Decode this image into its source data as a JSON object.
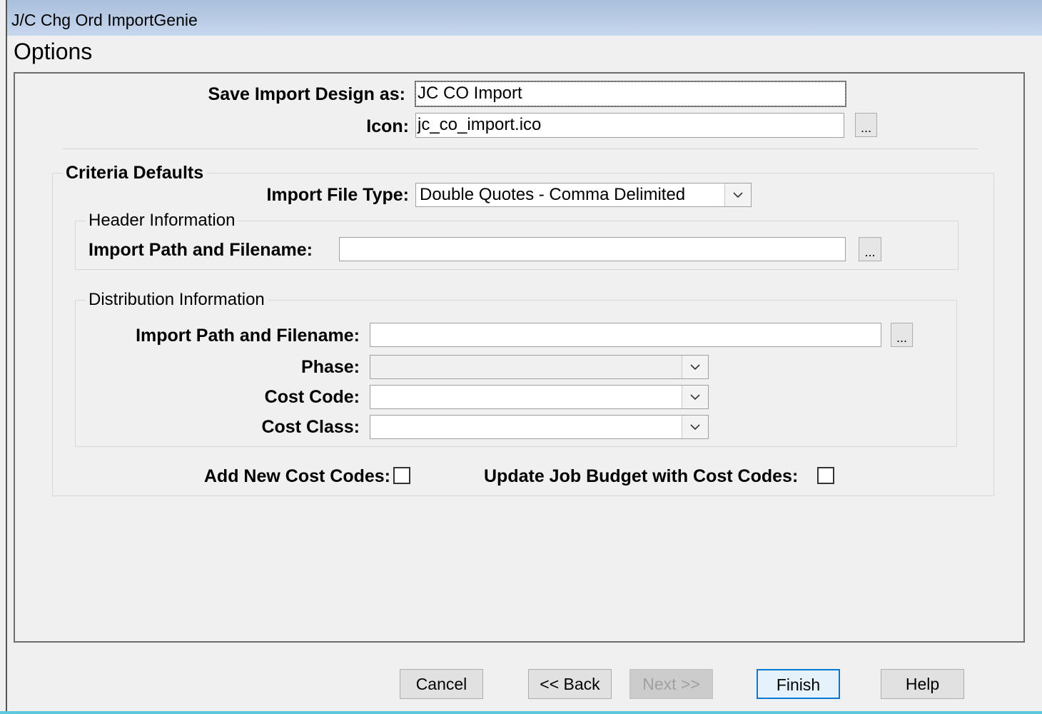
{
  "window": {
    "title": "J/C Chg Ord ImportGenie",
    "heading": "Options"
  },
  "design": {
    "save_label": "Save Import Design as:",
    "save_value": "JC CO Import",
    "icon_label": "Icon:",
    "icon_value": "jc_co_import.ico",
    "browse": "..."
  },
  "criteria": {
    "legend": "Criteria Defaults",
    "file_type_label": "Import File Type:",
    "file_type_value": "Double Quotes - Comma Delimited"
  },
  "header_info": {
    "legend": "Header Information",
    "path_label": "Import Path and Filename:",
    "path_value": ""
  },
  "distribution": {
    "legend": "Distribution Information",
    "path_label": "Import Path and Filename:",
    "path_value": "",
    "phase_label": "Phase:",
    "phase_value": "",
    "cost_code_label": "Cost Code:",
    "cost_code_value": "",
    "cost_class_label": "Cost Class:",
    "cost_class_value": ""
  },
  "options": {
    "add_cost_codes_label": "Add New Cost Codes:",
    "add_cost_codes_checked": false,
    "update_budget_label": "Update Job Budget with Cost Codes:",
    "update_budget_checked": false
  },
  "buttons": {
    "cancel": "Cancel",
    "back": "<< Back",
    "next": "Next >>",
    "finish": "Finish",
    "help": "Help"
  },
  "colors": {
    "default_button_border": "#0078d7",
    "title_gradient_top": "#a9bfdc",
    "title_gradient_bottom": "#c7d7ed"
  }
}
